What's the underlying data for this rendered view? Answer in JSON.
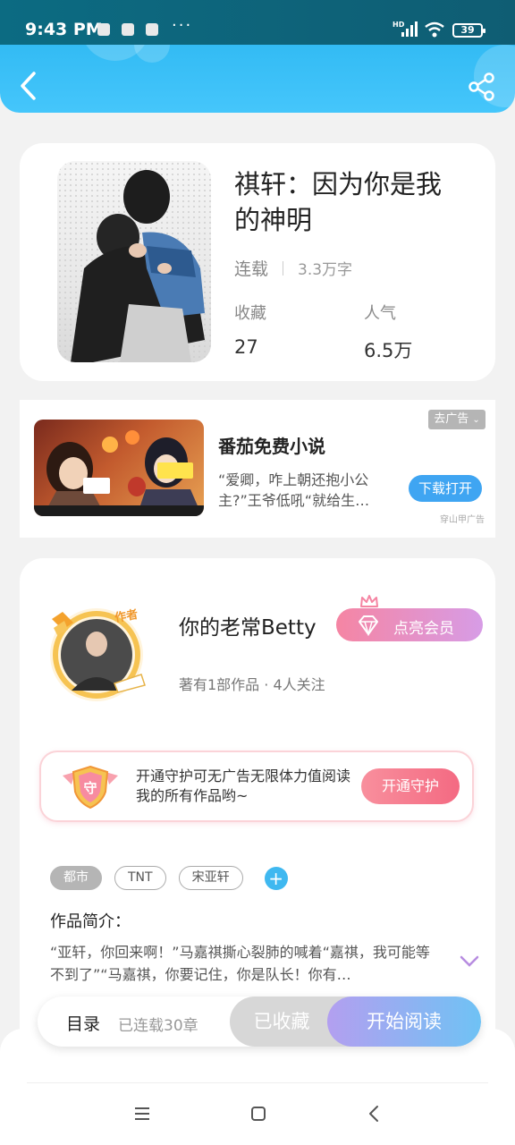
{
  "status_bar": {
    "time": "9:43 PM",
    "more": "···",
    "network": "HD",
    "battery": "39"
  },
  "book": {
    "title": "祺轩：因为你是我的神明",
    "status": "连载",
    "word_count": "3.3万字",
    "stats": [
      {
        "label": "收藏",
        "value": "27"
      },
      {
        "label": "人气",
        "value": "6.5万"
      }
    ]
  },
  "ad": {
    "close_label": "去广告",
    "title": "番茄免费小说",
    "description": "“爱卿，咋上朝还抱小公主?”王爷低吼“就给生…",
    "download_label": "下载打开",
    "source": "穿山甲广告",
    "badge": "作者"
  },
  "author": {
    "avatar_badge": "作者",
    "name": "你的老常Betty",
    "vip_label": "点亮会员",
    "stats": "著有1部作品 · 4人关注",
    "guard_text": "开通守护可无广告无限体力值阅读我的所有作品哟~",
    "guard_button": "开通守护",
    "guard_icon_char": "守"
  },
  "tags": [
    "都市",
    "TNT",
    "宋亚轩"
  ],
  "tag_add": "+",
  "intro": {
    "label": "作品简介：",
    "text": "“亚轩，你回来啊！”马嘉祺撕心裂肺的喊着“嘉祺，我可能等不到了”“马嘉祺，你要记住，你是队长！你有…"
  },
  "action_bar": {
    "toc_label": "目录",
    "updated_label": "已连载30章",
    "collected_label": "已收藏",
    "read_label": "开始阅读"
  },
  "colors": {
    "header": "#45c6fb",
    "accent_blue": "#3fb8f0",
    "vip_pink": "#f585a3",
    "guard_pink": "#f46a82"
  }
}
